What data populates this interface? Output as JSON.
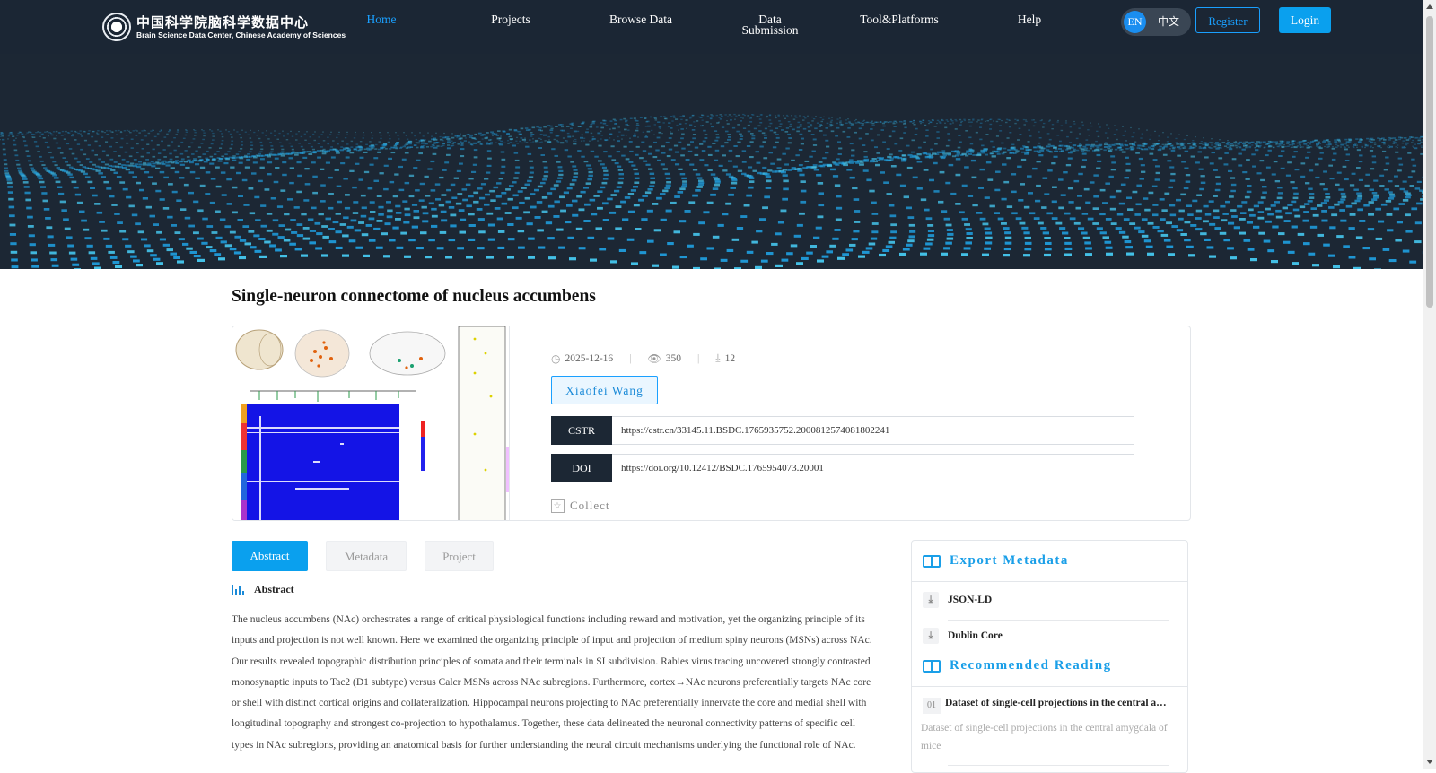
{
  "header": {
    "logo_cn": "中国科学院脑科学数据中心",
    "logo_en": "Brain Science Data Center, Chinese Academy of Sciences",
    "nav": [
      {
        "label": "Home"
      },
      {
        "label": "Projects"
      },
      {
        "label": "Browse Data"
      },
      {
        "label": "Data Submission"
      },
      {
        "label": "Tool&Platforms"
      },
      {
        "label": "Help"
      }
    ],
    "lang_en": "EN",
    "lang_cn": "中文",
    "register": "Register",
    "login": "Login"
  },
  "colors": {
    "header_bg": "#1b2634",
    "accent": "#1aa0ff",
    "primary_button": "#0aa0ee"
  },
  "dataset": {
    "title": "Single-neuron connectome of nucleus accumbens",
    "date": "2025-12-16",
    "views": "350",
    "downloads": "12",
    "author": "Xiaofei Wang",
    "cstr_label": "CSTR",
    "cstr_value": "https://cstr.cn/33145.11.BSDC.1765935752.2000812574081802241",
    "doi_label": "DOI",
    "doi_value": "https://doi.org/10.12412/BSDC.1765954073.20001",
    "collect": "Collect"
  },
  "tabs": [
    {
      "label": "Abstract",
      "active": true
    },
    {
      "label": "Metadata",
      "active": false
    },
    {
      "label": "Project",
      "active": false
    }
  ],
  "abstract": {
    "heading": "Abstract",
    "text": "The nucleus accumbens (NAc) orchestrates a range of critical physiological functions including reward and motivation, yet the organizing principle of its inputs and projection is not well known. Here we examined the organizing principle of input and projection of medium spiny neurons (MSNs) across NAc. Our results revealed topographic distribution principles of somata and their terminals in SI subdivision. Rabies virus tracing uncovered strongly contrasted monosynaptic inputs to Tac2 (D1 subtype) versus Calcr MSNs across NAc subregions. Furthermore, cortex→NAc neurons preferentially targets NAc core or shell with distinct cortical origins and collateralization. Hippocampal neurons projecting to NAc preferentially innervate the core and medial shell with longitudinal topography and strongest co-projection to hypothalamus. Together, these data delineated the neuronal connectivity patterns of specific cell types in NAc subregions, providing an anatomical basis for further understanding the neural circuit mechanisms underlying the functional role of NAc."
  },
  "sidebar": {
    "export_title": "Export Metadata",
    "export_items": [
      {
        "label": "JSON-LD"
      },
      {
        "label": "Dublin Core"
      }
    ],
    "recommended_title": "Recommended Reading",
    "recommended": [
      {
        "num": "01",
        "title": "Dataset of single-cell projections in the central amygdala of mice",
        "desc": "Dataset of single-cell projections in the central amygdala of mice"
      }
    ]
  },
  "icons": {
    "date": "clock-icon",
    "views": "eye-icon",
    "downloads": "download-icon",
    "collect": "star-icon",
    "export": "download-icon",
    "section": "book-icon"
  }
}
